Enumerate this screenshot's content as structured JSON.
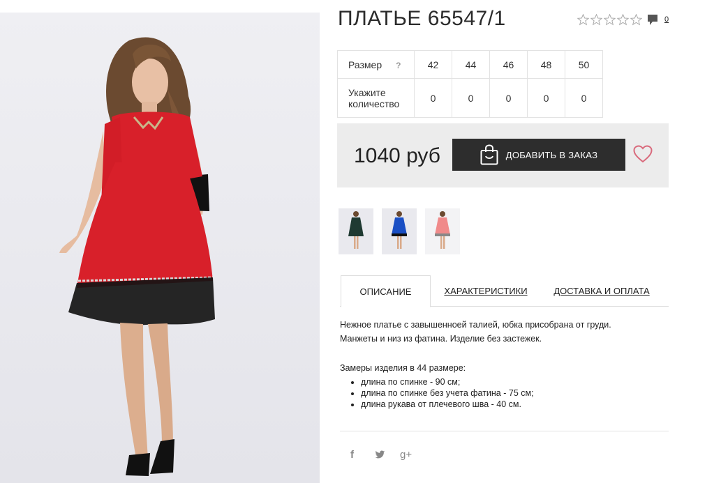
{
  "product": {
    "title": "ПЛАТЬЕ 65547/1",
    "comment_count": "0",
    "price": "1040 руб",
    "add_to_order_label": "ДОБАВИТЬ В ЗАКАЗ"
  },
  "size_table": {
    "size_label": "Размер",
    "help_mark": "?",
    "sizes": [
      "42",
      "44",
      "46",
      "48",
      "50"
    ],
    "qty_label_line1": "Укажите",
    "qty_label_line2": "количество",
    "quantities": [
      "0",
      "0",
      "0",
      "0",
      "0"
    ]
  },
  "thumbnails": [
    {
      "dress_color": "#1f3a32"
    },
    {
      "dress_color": "#1a4fc4"
    },
    {
      "dress_color": "#f08a8a"
    }
  ],
  "tabs": [
    "ОПИСАНИЕ",
    "ХАРАКТЕРИСТИКИ",
    "ДОСТАВКА И ОПЛАТА"
  ],
  "description": {
    "line1": "Нежное платье с завышенноей талией, юбка присобрана от груди.",
    "line2": "Манжеты и низ из фатина. Изделие без застежек.",
    "measure_title": "Замеры изделия в 44 размере:",
    "bullets": [
      "длина по спинке - 90 см;",
      "длина по спинке без учета фатина - 75 см;",
      "длина рукава от плечевого шва - 40 см."
    ]
  },
  "social": [
    "f",
    "t",
    "g+"
  ],
  "colors": {
    "dress_main": "#d8202a",
    "tulle": "#111111",
    "button_bg": "#2d2d2d",
    "heart": "#d96a7c"
  }
}
